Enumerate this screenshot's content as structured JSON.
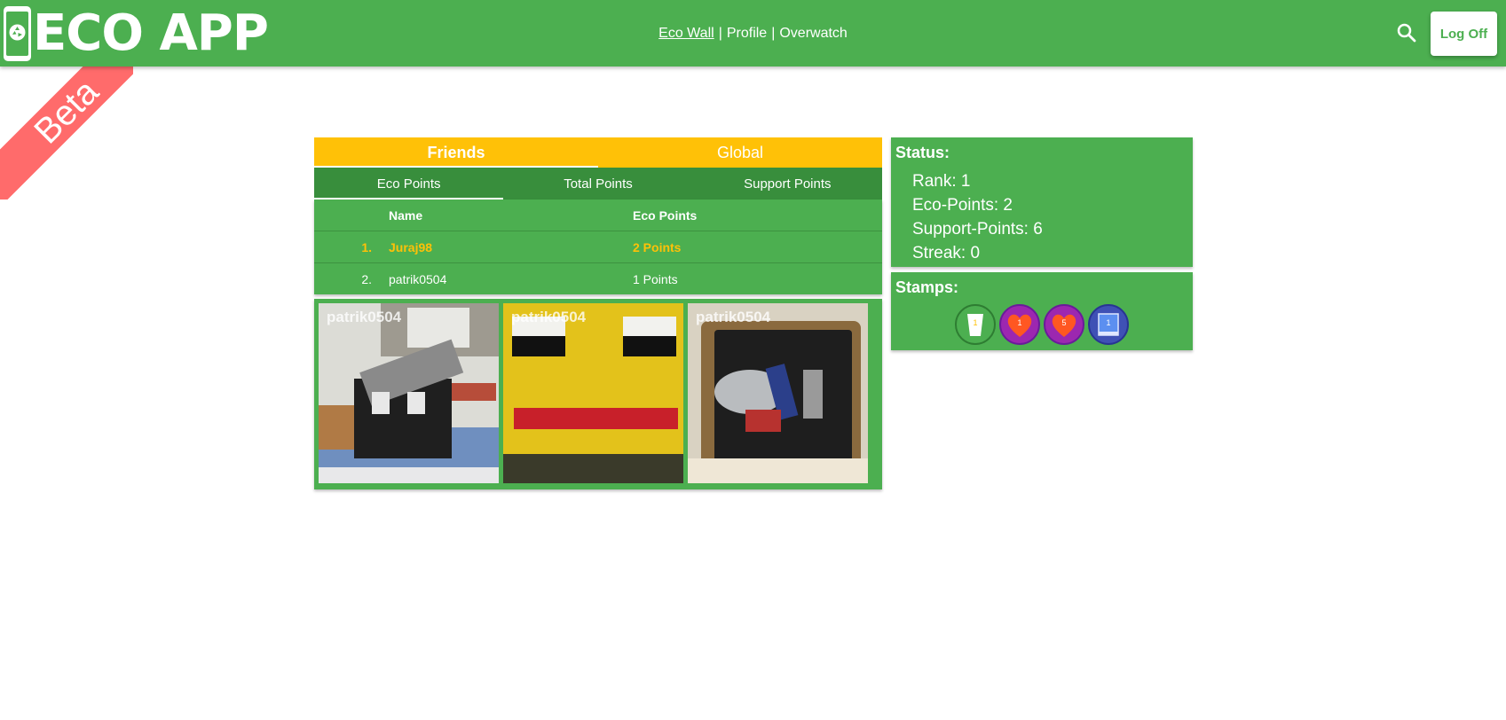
{
  "header": {
    "logo_text": "ECO APP",
    "nav": [
      {
        "label": "Eco Wall"
      },
      {
        "label": "Profile"
      },
      {
        "label": "Overwatch"
      }
    ],
    "separator": "|",
    "logoff_label": "Log Off"
  },
  "ribbon": {
    "label": "Beta"
  },
  "leaderboard": {
    "main_tabs": [
      "Friends",
      "Global"
    ],
    "sub_tabs": [
      "Eco Points",
      "Total Points",
      "Support Points"
    ],
    "columns": [
      "Name",
      "Eco Points"
    ],
    "rows": [
      {
        "rank": "1.",
        "name": "Juraj98",
        "points": "2 Points"
      },
      {
        "rank": "2.",
        "name": "patrik0504",
        "points": "1 Points"
      }
    ]
  },
  "gallery": [
    {
      "user": "patrik0504"
    },
    {
      "user": "patrik0504"
    },
    {
      "user": "patrik0504"
    }
  ],
  "status": {
    "title": "Status:",
    "rank": "Rank: 1",
    "eco_points": "Eco-Points: 2",
    "support_points": "Support-Points: 6",
    "streak": "Streak: 0"
  },
  "stamps": {
    "title": "Stamps:",
    "items": [
      {
        "icon": "cup-icon",
        "count": "1",
        "color": "#4caf50"
      },
      {
        "icon": "heart-icon",
        "count": "1",
        "color": "#9c27b0"
      },
      {
        "icon": "heart-icon",
        "count": "5",
        "color": "#9c27b0"
      },
      {
        "icon": "screen-icon",
        "count": "1",
        "color": "#3f51b5"
      }
    ]
  },
  "colors": {
    "primary": "#4caf50",
    "dark": "#388e3c",
    "accent": "#ffc107",
    "ribbon": "#ff6b6b"
  }
}
